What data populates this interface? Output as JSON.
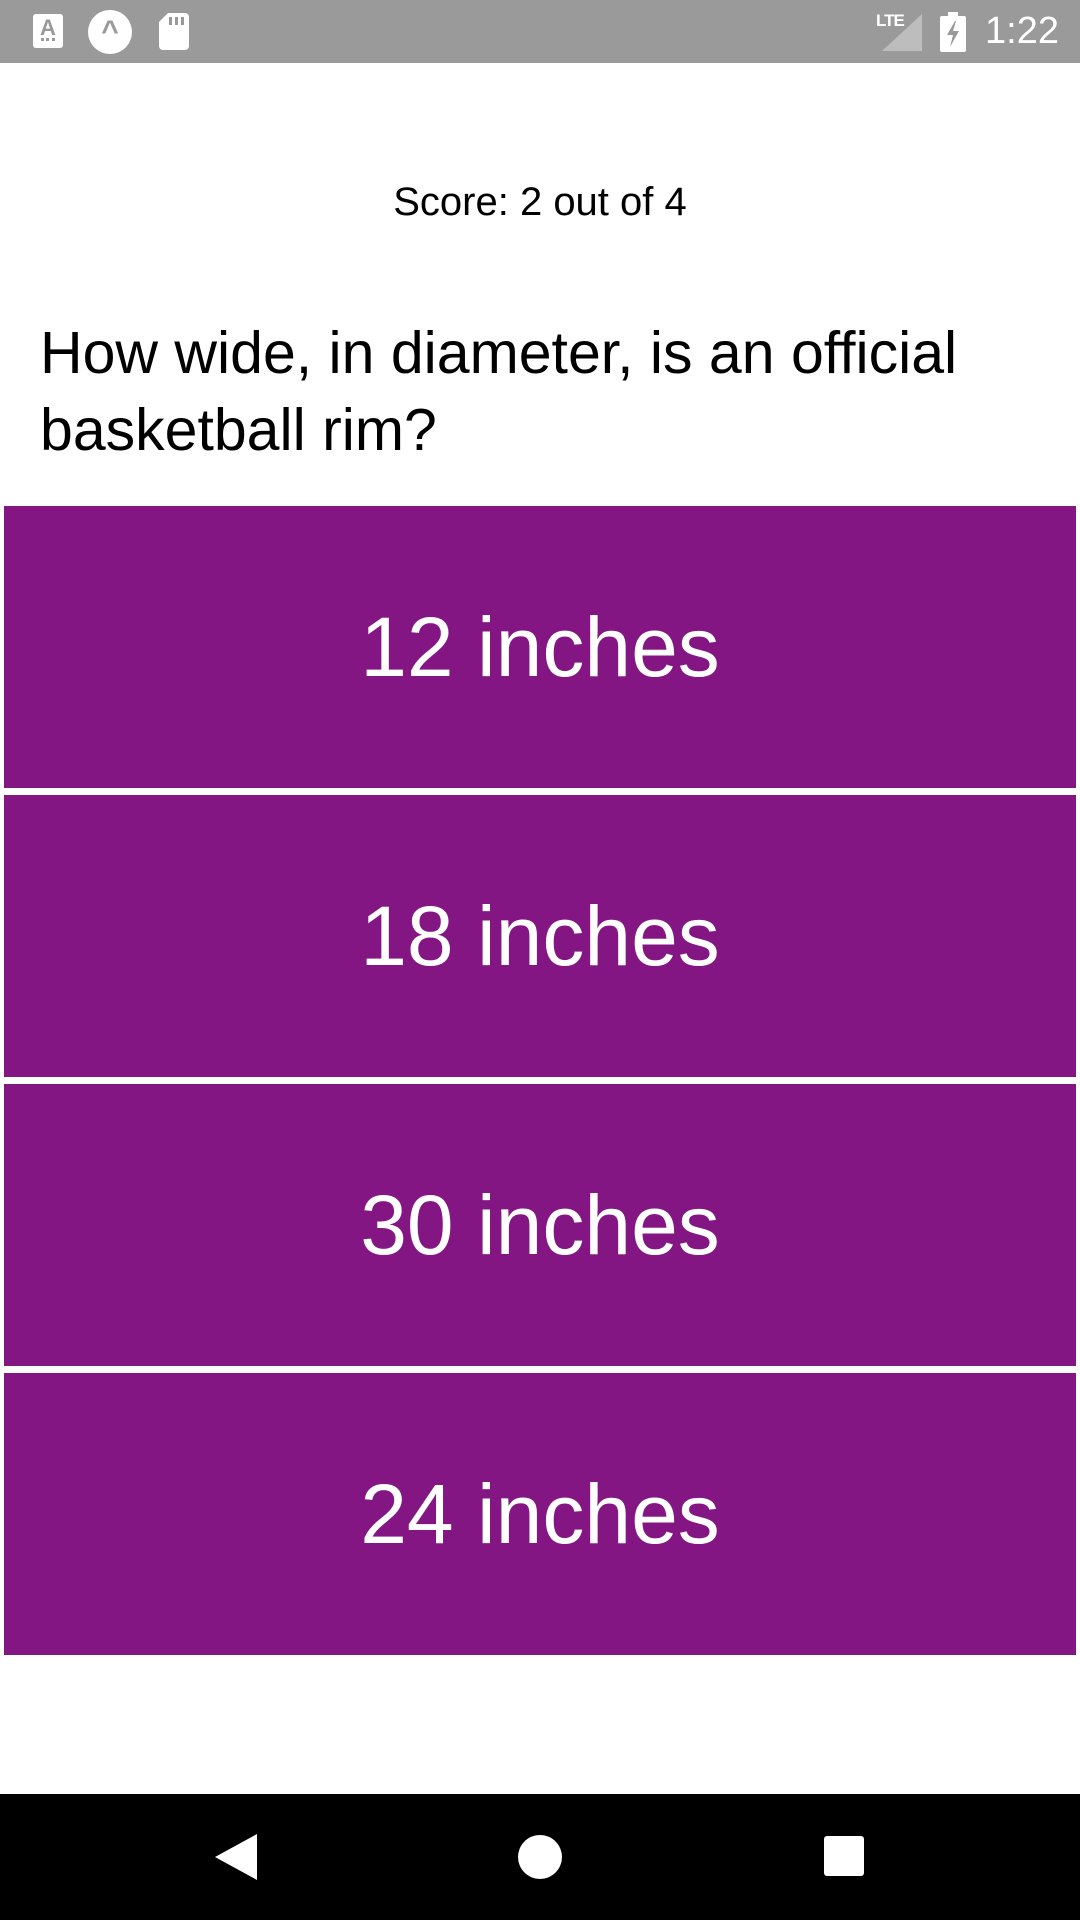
{
  "status_bar": {
    "time": "1:22",
    "network_label": "LTE",
    "icons": [
      "app-notification-icon",
      "arch-app-icon",
      "sd-card-icon",
      "signal-icon",
      "battery-charging-icon"
    ]
  },
  "score": {
    "text": "Score: 2 out of 4"
  },
  "question": {
    "text": "How wide, in diameter, is an official basketball rim?"
  },
  "answers": [
    {
      "label": "12 inches"
    },
    {
      "label": "18 inches"
    },
    {
      "label": "30 inches"
    },
    {
      "label": "24 inches"
    }
  ],
  "colors": {
    "answer_background": "#841684",
    "status_bar": "#9a9a9a",
    "nav_bar": "#000000"
  },
  "nav_bar": {
    "icons": [
      "back-icon",
      "home-icon",
      "recents-icon"
    ]
  }
}
